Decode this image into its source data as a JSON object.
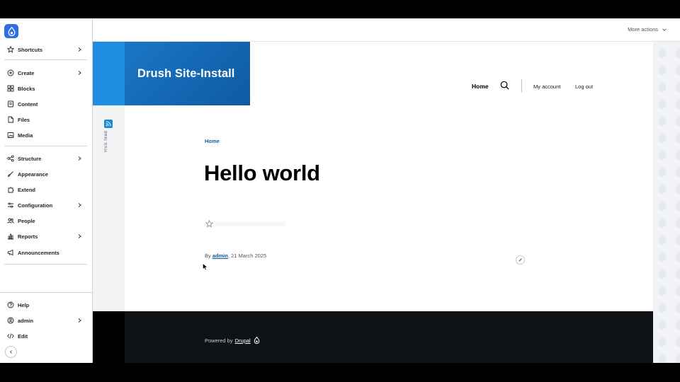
{
  "sidebar": {
    "logo_icon": "drupal-drop-icon",
    "items": [
      {
        "label": "Shortcuts",
        "icon": "star-icon",
        "has_children": true
      },
      {
        "label": "Create",
        "icon": "plus-circle-icon",
        "has_children": true
      },
      {
        "label": "Blocks",
        "icon": "grid-icon",
        "has_children": false
      },
      {
        "label": "Content",
        "icon": "document-icon",
        "has_children": false
      },
      {
        "label": "Files",
        "icon": "file-icon",
        "has_children": false
      },
      {
        "label": "Media",
        "icon": "image-icon",
        "has_children": false
      },
      {
        "label": "Structure",
        "icon": "sitemap-icon",
        "has_children": true
      },
      {
        "label": "Appearance",
        "icon": "brush-icon",
        "has_children": false
      },
      {
        "label": "Extend",
        "icon": "puzzle-icon",
        "has_children": false
      },
      {
        "label": "Configuration",
        "icon": "sliders-icon",
        "has_children": true
      },
      {
        "label": "People",
        "icon": "people-icon",
        "has_children": false
      },
      {
        "label": "Reports",
        "icon": "chart-icon",
        "has_children": true
      },
      {
        "label": "Announcements",
        "icon": "megaphone-icon",
        "has_children": false
      }
    ],
    "bottom_items": [
      {
        "label": "Help",
        "icon": "help-icon",
        "has_children": false
      },
      {
        "label": "admin",
        "icon": "user-icon",
        "has_children": true
      },
      {
        "label": "Edit",
        "icon": "code-icon",
        "has_children": false
      }
    ],
    "collapse_icon": "chevron-left-icon"
  },
  "topbar": {
    "more_actions": "More actions"
  },
  "site": {
    "name": "Drush Site-Install",
    "main_nav": "Home",
    "account_links": [
      "My account",
      "Log out"
    ],
    "rss_label": "RSS feed",
    "breadcrumb": "Home",
    "title": "Hello world",
    "byline_prefix": "By",
    "author": "admin",
    "date": ", 21 March 2025",
    "footer_powered": "Powered by",
    "footer_link": "Drupal"
  },
  "colors": {
    "brand_blue": "#1f8ee0",
    "brand_dark_blue": "#0f5aa3",
    "logo_blue": "#2f6ee4",
    "footer_bg": "#0f1214"
  }
}
